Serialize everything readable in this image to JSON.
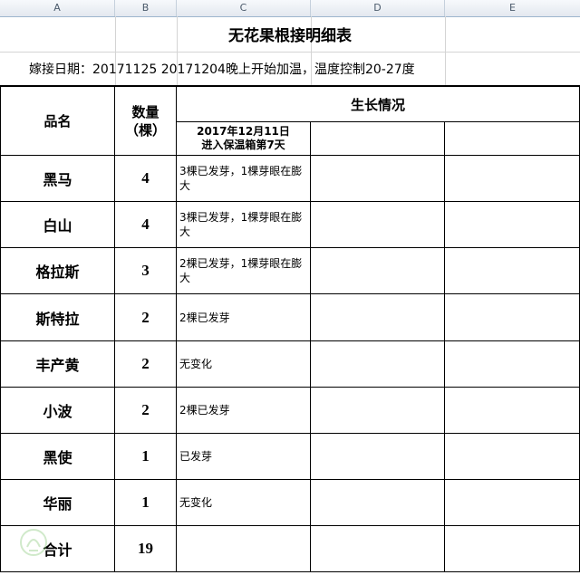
{
  "column_headers": [
    "A",
    "B",
    "C",
    "D",
    "E"
  ],
  "sheet": {
    "title": "无花果根接明细表",
    "info": "嫁接日期：20171125   20171204晚上开始加温，温度控制20-27度",
    "header": {
      "name": "品名",
      "qty_line1": "数量",
      "qty_line2": "（棵）",
      "growth": "生长情况",
      "date_line1": "2017年12月11日",
      "date_line2": "进入保温箱第7天"
    },
    "rows": [
      {
        "name": "黑马",
        "qty": "4",
        "status": "3棵已发芽，1棵芽眼在膨大"
      },
      {
        "name": "白山",
        "qty": "4",
        "status": "3棵已发芽，1棵芽眼在膨大"
      },
      {
        "name": "格拉斯",
        "qty": "3",
        "status": "2棵已发芽，1棵芽眼在膨大"
      },
      {
        "name": "斯特拉",
        "qty": "2",
        "status": "2棵已发芽"
      },
      {
        "name": "丰产黄",
        "qty": "2",
        "status": "无变化"
      },
      {
        "name": "小波",
        "qty": "2",
        "status": "2棵已发芽"
      },
      {
        "name": "黑使",
        "qty": "1",
        "status": "已发芽"
      },
      {
        "name": "华丽",
        "qty": "1",
        "status": "无变化"
      }
    ],
    "total": {
      "name": "合计",
      "qty": "19"
    }
  },
  "colors": {
    "grid_light": "#d4d4d4",
    "grid_border": "#000000",
    "header_bg": "#e3e8ef"
  }
}
